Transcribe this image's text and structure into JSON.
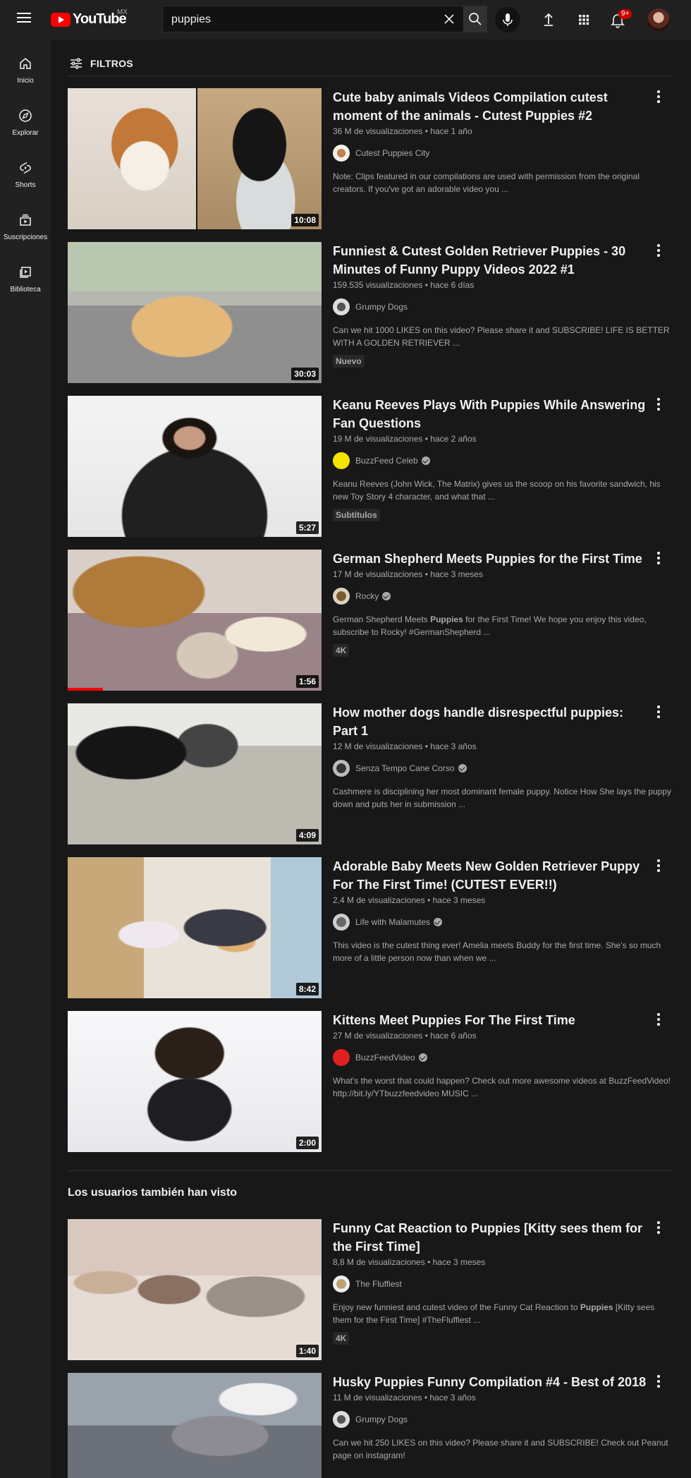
{
  "header": {
    "logo_text": "YouTube",
    "country": "MX",
    "search_value": "puppies",
    "notifications_count": "9+"
  },
  "rail": {
    "items": [
      {
        "label": "Inicio",
        "icon": "home-icon"
      },
      {
        "label": "Explorar",
        "icon": "compass-icon"
      },
      {
        "label": "Shorts",
        "icon": "shorts-icon"
      },
      {
        "label": "Suscripciones",
        "icon": "subscriptions-icon"
      },
      {
        "label": "Biblioteca",
        "icon": "library-icon"
      }
    ]
  },
  "filters": {
    "label": "FILTROS"
  },
  "results": [
    {
      "title": "Cute baby animals Videos Compilation cutest moment of the animals - Cutest Puppies #2",
      "meta": "36 M de visualizaciones • hace 1 año",
      "channel": "Cutest Puppies City",
      "description": "Note: Clips featured in our compilations are used with permission from the original creators. If you've got an adorable video you ...",
      "duration": "10:08"
    },
    {
      "title": "Funniest & Cutest Golden Retriever Puppies - 30 Minutes of Funny Puppy Videos 2022 #1",
      "meta": "159.535 visualizaciones • hace 6 días",
      "channel": "Grumpy Dogs",
      "description": "Can we hit 1000 LIKES on this video? Please share it and SUBSCRIBE! LIFE IS BETTER WITH A GOLDEN RETRIEVER ...",
      "badge": "Nuevo",
      "duration": "30:03"
    },
    {
      "title": "Keanu Reeves Plays With Puppies While Answering Fan Questions",
      "meta": "19 M de visualizaciones • hace 2 años",
      "channel": "BuzzFeed Celeb",
      "description": "Keanu Reeves (John Wick, The Matrix) gives us the scoop on his favorite sandwich, his new Toy Story 4 character, and what that ...",
      "badge": "Subtítulos",
      "duration": "5:27"
    },
    {
      "title": "German Shepherd Meets Puppies for the First Time",
      "meta": "17 M de visualizaciones • hace 3 meses",
      "channel": "Rocky",
      "description_pre": "German Shepherd Meets ",
      "description_bold": "Puppies",
      "description_post": " for the First Time! We hope you enjoy this video, subscribe to Rocky! #GermanShepherd ...",
      "badge": "4K",
      "duration": "1:56",
      "watched_fraction": 0.14
    },
    {
      "title": "How mother dogs handle disrespectful puppies: Part 1",
      "meta": "12 M de visualizaciones • hace 3 años",
      "channel": "Senza Tempo Cane Corso",
      "description": "Cashmere is disciplining her most dominant female puppy. Notice How She lays the puppy down and puts her in submission ...",
      "duration": "4:09"
    },
    {
      "title": "Adorable Baby Meets New Golden Retriever Puppy For The First Time! (CUTEST EVER!!)",
      "meta": "2,4 M de visualizaciones • hace 3 meses",
      "channel": "Life with Malamutes",
      "description": "This video is the cutest thing ever! Amelia meets Buddy for the first time. She's so much more of a little person now than when we ...",
      "duration": "8:42"
    },
    {
      "title": "Kittens Meet Puppies For The First Time",
      "meta": "27 M de visualizaciones • hace 6 años",
      "channel": "BuzzFeedVideo",
      "description": "What's the worst that could happen? Check out more awesome videos at BuzzFeedVideo! http://bit.ly/YTbuzzfeedvideo MUSIC ...",
      "duration": "2:00"
    }
  ],
  "also_watched": {
    "heading": "Los usuarios también han visto",
    "items": [
      {
        "title": "Funny Cat Reaction to Puppies [Kitty sees them for the First Time]",
        "meta": "8,8 M de visualizaciones • hace 3 meses",
        "channel": "The Fluffiest",
        "description_pre": "Enjoy new funniest and cutest video of the Funny Cat Reaction to ",
        "description_bold": "Puppies",
        "description_post": " [Kitty sees them for the First Time] #TheFluffiest ...",
        "badge": "4K",
        "duration": "1:40"
      },
      {
        "title": "Husky Puppies Funny Compilation #4 - Best of 2018",
        "meta": "11 M de visualizaciones • hace 3 años",
        "channel": "Grumpy Dogs",
        "description": "Can we hit 250 LIKES on this video? Please share it and SUBSCRIBE! Check out Peanut page on instagram!"
      }
    ]
  }
}
